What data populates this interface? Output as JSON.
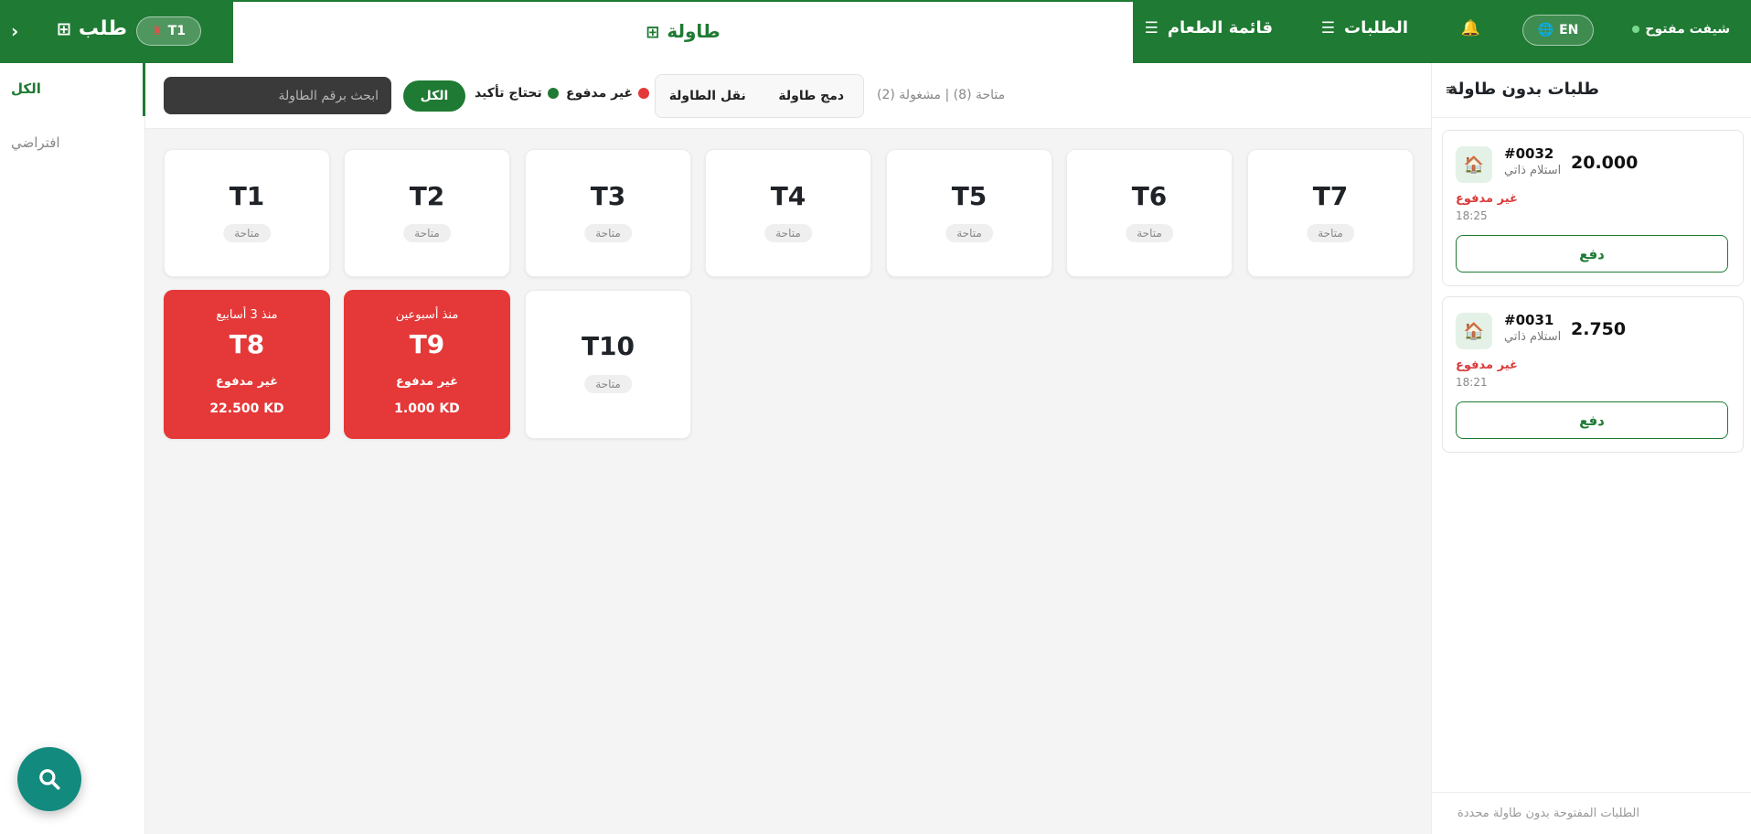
{
  "topbar": {
    "shift_label": "شيفت مفتوح",
    "lang_label": "EN",
    "nav_orders": "الطلبات",
    "nav_menu": "قائمة الطعام",
    "page_title": "طاولة",
    "order_label": "طلب",
    "table_chip": "T1",
    "collapse_icon": "chevron-right",
    "colors": {
      "brand": "#1f7a33",
      "bell": "#ffd54a"
    }
  },
  "categories": [
    {
      "label": "الكل",
      "active": true
    },
    {
      "label": "افتراضي",
      "active": false
    }
  ],
  "filters": {
    "search_placeholder": "ابحث برقم الطاولة",
    "all_button": "الكل",
    "legend_confirm": "تحتاج تأكيد",
    "legend_unpaid": "غير مدفوع",
    "merge_table": "دمج طاولة",
    "move_table": "نقل الطاولة",
    "counts": "متاحة (8) | مشغولة (2)",
    "colors": {
      "confirm": "#1f7a33",
      "unpaid": "#e53838"
    }
  },
  "tables": [
    {
      "name": "T1",
      "status": "متاحة"
    },
    {
      "name": "T2",
      "status": "متاحة"
    },
    {
      "name": "T3",
      "status": "متاحة"
    },
    {
      "name": "T4",
      "status": "متاحة"
    },
    {
      "name": "T5",
      "status": "متاحة"
    },
    {
      "name": "T6",
      "status": "متاحة"
    },
    {
      "name": "T7",
      "status": "متاحة"
    },
    {
      "name": "T8",
      "since": "منذ 3 أسابيع",
      "payment": "غير مدفوع",
      "amount": "22.500 KD"
    },
    {
      "name": "T9",
      "since": "منذ أسبوعين",
      "payment": "غير مدفوع",
      "amount": "1.000 KD"
    },
    {
      "name": "T10",
      "status": "متاحة"
    }
  ],
  "no_table_orders": {
    "title": "طلبات بدون طاولة",
    "footer": "الطلبات المفتوحة بدون طاولة محددة",
    "orders": [
      {
        "number": "#0032",
        "type": "استلام ذاتي",
        "amount": "20.000",
        "status": "غير مدفوع",
        "time": "18:25",
        "pay_label": "دفع"
      },
      {
        "number": "#0031",
        "type": "استلام ذاتي",
        "amount": "2.750",
        "status": "غير مدفوع",
        "time": "18:21",
        "pay_label": "دفع"
      }
    ]
  }
}
